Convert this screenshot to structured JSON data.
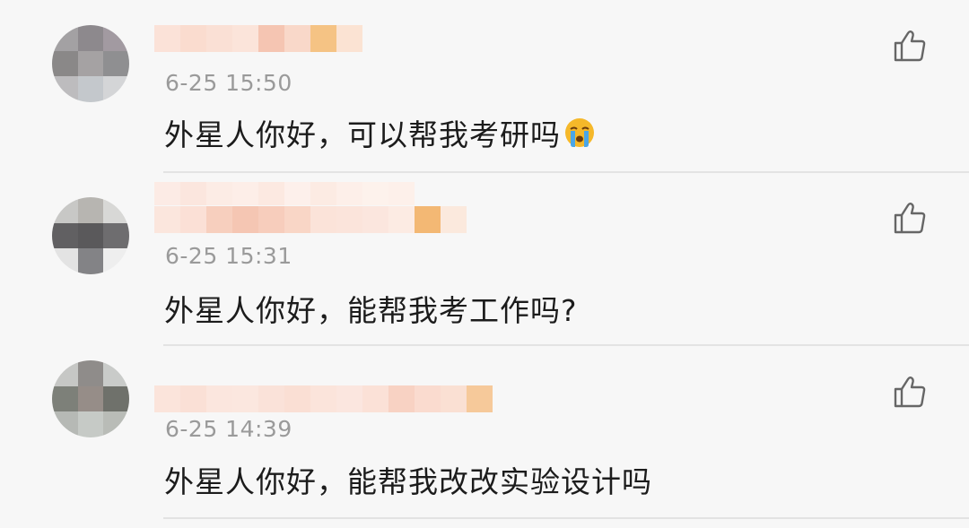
{
  "comments": [
    {
      "timestamp": "6-25 15:50",
      "text": "外星人你好，可以帮我考研吗",
      "emoji": "crying-face"
    },
    {
      "timestamp": "6-25 15:31",
      "text": "外星人你好，能帮我考工作吗?"
    },
    {
      "timestamp": "6-25 14:39",
      "text": "外星人你好，能帮我改改实验设计吗"
    }
  ],
  "icons": {
    "like": "thumbs-up-icon"
  },
  "colors": {
    "background": "#f7f7f7",
    "timestamp": "#9a9a9a",
    "text": "#1c1c1c",
    "divider": "#e3e3e3",
    "like_icon": "#666666"
  }
}
